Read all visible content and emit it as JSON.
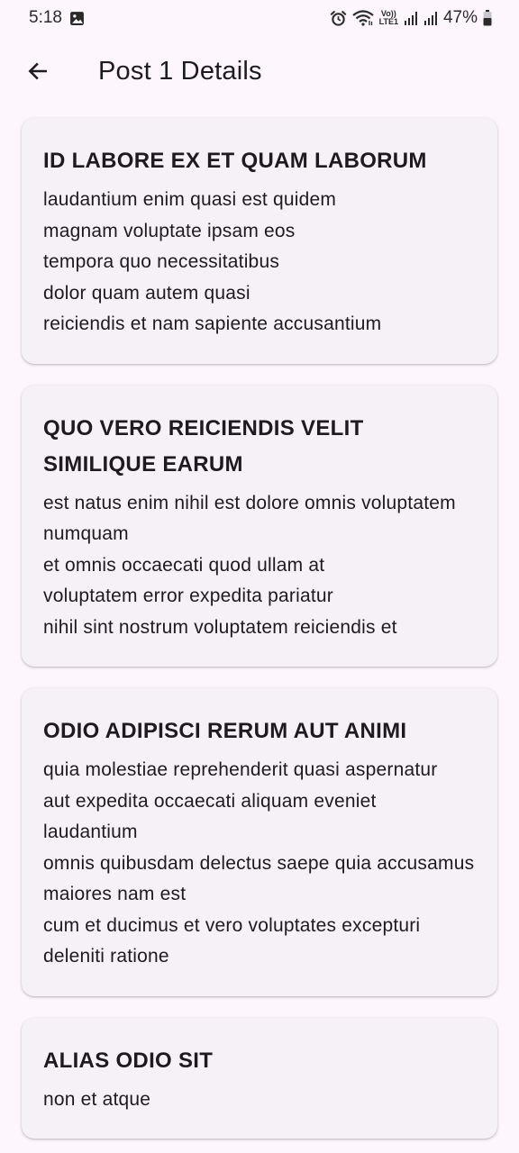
{
  "status_bar": {
    "time": "5:18",
    "battery": "47%",
    "volte_top": "Vo))",
    "volte_bottom": "LTE1"
  },
  "app_bar": {
    "title": "Post 1 Details"
  },
  "comments": [
    {
      "title": "ID LABORE EX ET QUAM LABORUM",
      "body": "laudantium enim quasi est quidem\nmagnam voluptate ipsam eos\ntempora quo necessitatibus\ndolor quam autem quasi\nreiciendis et nam sapiente accusantium"
    },
    {
      "title": "QUO VERO REICIENDIS VELIT SIMILIQUE EARUM",
      "body": "est natus enim nihil est dolore omnis voluptatem numquam\net omnis occaecati quod ullam at\nvoluptatem error expedita pariatur\nnihil sint nostrum voluptatem reiciendis et"
    },
    {
      "title": "ODIO ADIPISCI RERUM AUT ANIMI",
      "body": "quia molestiae reprehenderit quasi aspernatur\naut expedita occaecati aliquam eveniet laudantium\nomnis quibusdam delectus saepe quia accusamus maiores nam est\ncum et ducimus et vero voluptates excepturi deleniti ratione"
    },
    {
      "title": "ALIAS ODIO SIT",
      "body": "non et atque"
    }
  ]
}
